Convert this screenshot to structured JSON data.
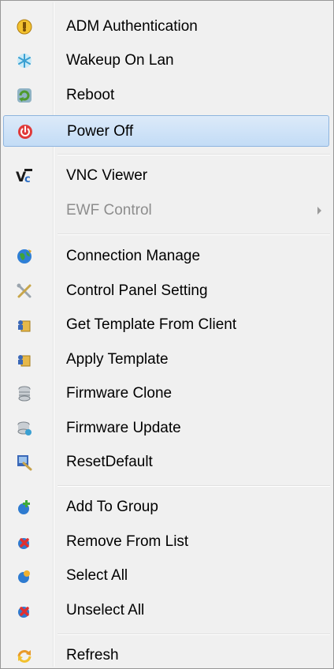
{
  "menu": {
    "items": [
      {
        "label": "ADM Authentication",
        "icon": "lock-icon"
      },
      {
        "label": "Wakeup On Lan",
        "icon": "snowflake-icon"
      },
      {
        "label": "Reboot",
        "icon": "reboot-icon"
      },
      {
        "label": "Power Off",
        "icon": "power-icon",
        "highlighted": true
      },
      {
        "label": "VNC Viewer",
        "icon": "vnc-icon"
      },
      {
        "label": "EWF Control",
        "icon": "",
        "disabled": true,
        "submenu": true
      },
      {
        "label": "Connection Manage",
        "icon": "globe-icon"
      },
      {
        "label": "Control Panel Setting",
        "icon": "tools-icon"
      },
      {
        "label": "Get Template From Client",
        "icon": "template-icon"
      },
      {
        "label": "Apply Template",
        "icon": "template-icon"
      },
      {
        "label": "Firmware Clone",
        "icon": "database-icon"
      },
      {
        "label": "Firmware Update",
        "icon": "database-update-icon"
      },
      {
        "label": "ResetDefault",
        "icon": "reset-icon"
      },
      {
        "label": "Add To Group",
        "icon": "add-user-icon"
      },
      {
        "label": "Remove From List",
        "icon": "remove-user-icon"
      },
      {
        "label": "Select All",
        "icon": "select-all-icon"
      },
      {
        "label": "Unselect All",
        "icon": "unselect-all-icon"
      },
      {
        "label": "Refresh",
        "icon": "refresh-icon"
      }
    ]
  },
  "colors": {
    "highlight_top": "#dceaf9",
    "highlight_bottom": "#c3dcf6",
    "highlight_border": "#8eb4de",
    "disabled_text": "#8d8d8d"
  }
}
